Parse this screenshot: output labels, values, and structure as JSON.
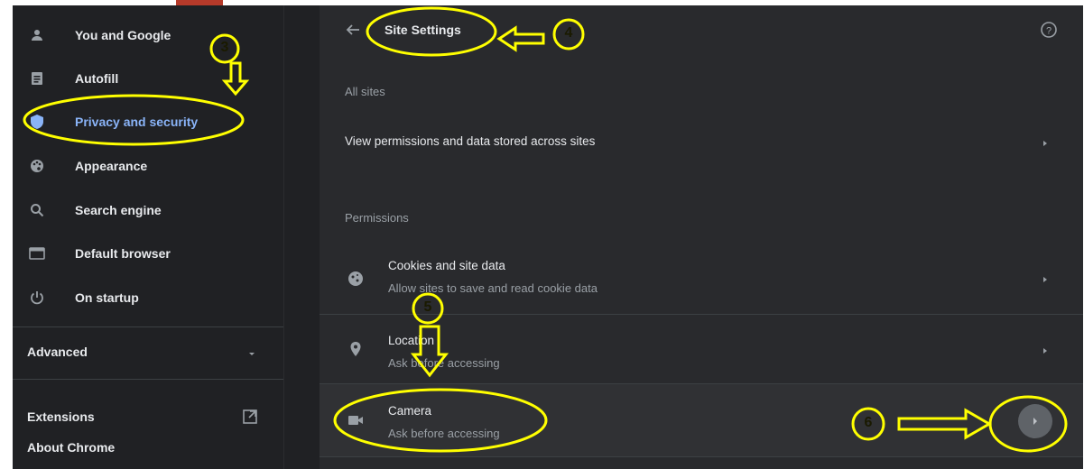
{
  "sidebar": {
    "items": [
      {
        "label": "You and Google",
        "icon": "person-icon",
        "active": false
      },
      {
        "label": "Autofill",
        "icon": "clipboard-icon",
        "active": false
      },
      {
        "label": "Privacy and security",
        "icon": "shield-icon",
        "active": true
      },
      {
        "label": "Appearance",
        "icon": "palette-icon",
        "active": false
      },
      {
        "label": "Search engine",
        "icon": "search-icon",
        "active": false
      },
      {
        "label": "Default browser",
        "icon": "browser-icon",
        "active": false
      },
      {
        "label": "On startup",
        "icon": "power-icon",
        "active": false
      }
    ],
    "advanced_label": "Advanced",
    "extensions_label": "Extensions",
    "about_label": "About Chrome"
  },
  "header": {
    "title": "Site Settings",
    "back_icon": "arrow-back-icon",
    "help_icon": "help-icon"
  },
  "main": {
    "all_sites_label": "All sites",
    "view_permissions_label": "View permissions and data stored across sites",
    "permissions_label": "Permissions",
    "permissions": [
      {
        "title": "Cookies and site data",
        "subtitle": "Allow sites to save and read cookie data",
        "icon": "cookie-icon"
      },
      {
        "title": "Location",
        "subtitle": "Ask before accessing",
        "icon": "location-pin-icon"
      },
      {
        "title": "Camera",
        "subtitle": "Ask before accessing",
        "icon": "camera-icon"
      }
    ]
  },
  "annotations": {
    "color": "#ffff00",
    "step_3": "3",
    "step_4": "4",
    "step_5": "5",
    "step_6": "6"
  }
}
